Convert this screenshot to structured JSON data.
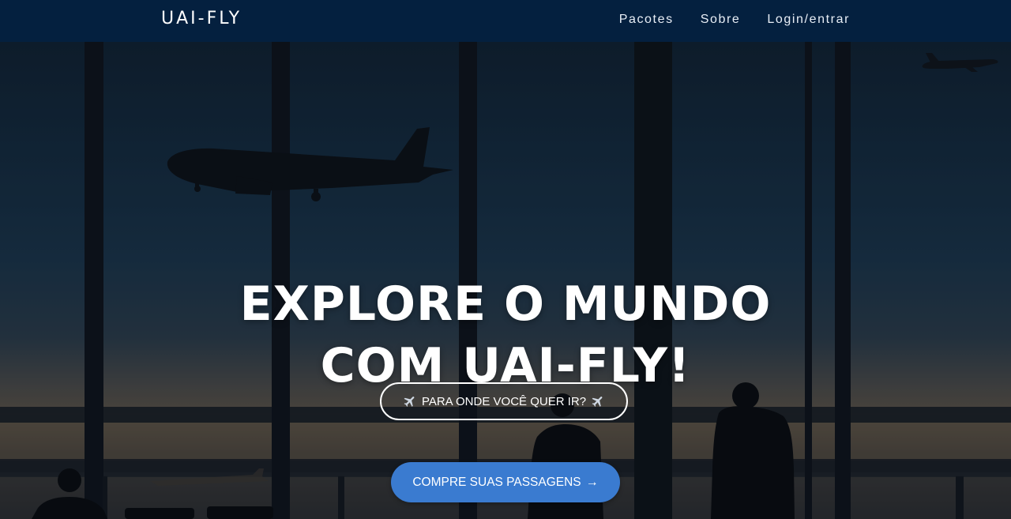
{
  "navbar": {
    "brand": "UAI-FLY",
    "links": [
      {
        "label": "Pacotes"
      },
      {
        "label": "Sobre"
      },
      {
        "label": "Login/entrar"
      }
    ]
  },
  "hero": {
    "headline_line1": "EXPLORE O MUNDO",
    "headline_line2": "COM UAI-FLY!",
    "destination_button": {
      "label": "PARA ONDE VOCÊ QUER IR?",
      "icon": "airplane-icon"
    },
    "buy_button": {
      "label": "COMPRE SUAS PASSAGENS",
      "icon": "arrow-right-icon"
    }
  },
  "colors": {
    "navbar_bg": "#04203f",
    "primary_button": "#3a7bd0",
    "text": "#ffffff"
  }
}
